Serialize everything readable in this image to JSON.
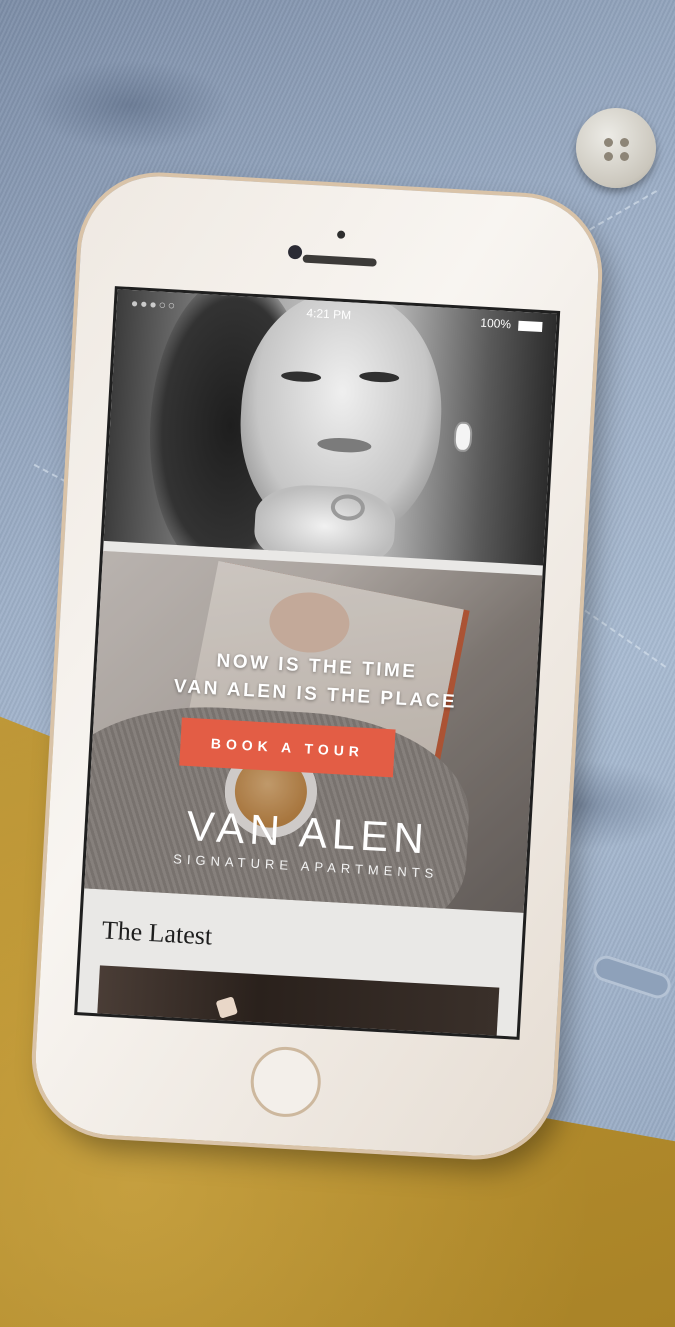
{
  "status_bar": {
    "time": "4:21 PM",
    "battery": "100%",
    "signal": "●●●○○"
  },
  "promo": {
    "headline_line1": "NOW IS THE TIME",
    "headline_line2": "VAN ALEN IS THE PLACE",
    "cta_label": "BOOK A TOUR",
    "brand_name": "VAN ALEN",
    "brand_tagline": "SIGNATURE APARTMENTS"
  },
  "latest": {
    "title": "The Latest"
  },
  "colors": {
    "cta": "#e35d45",
    "screen_bg": "#e9e8e6"
  }
}
